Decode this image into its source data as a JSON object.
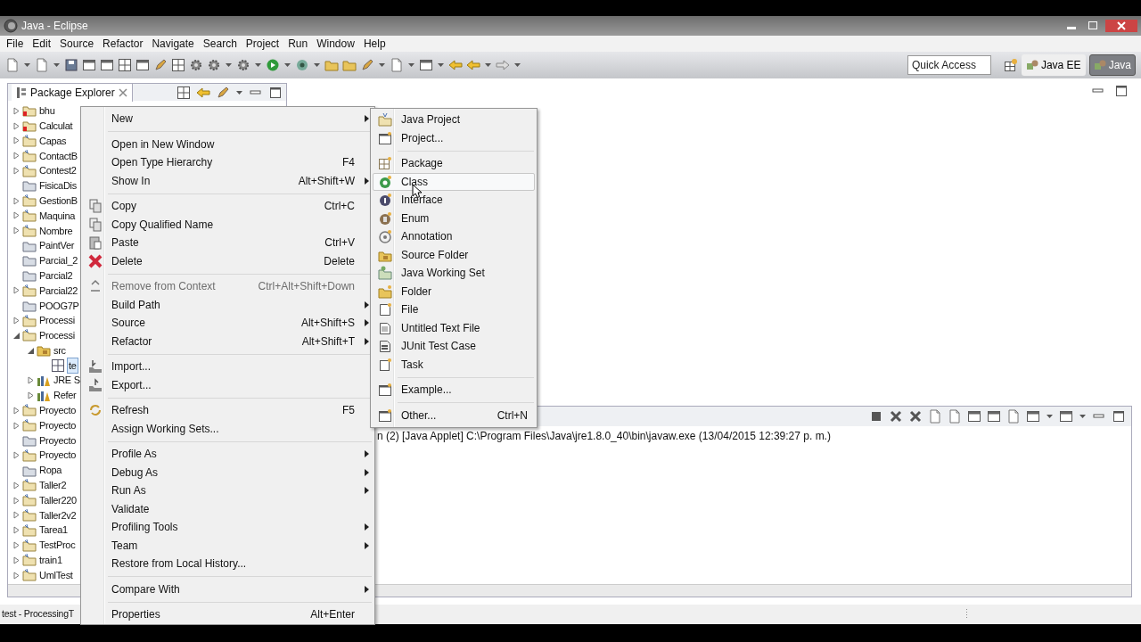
{
  "window": {
    "title": "Java - Eclipse"
  },
  "menu_bar": [
    "File",
    "Edit",
    "Source",
    "Refactor",
    "Navigate",
    "Search",
    "Project",
    "Run",
    "Window",
    "Help"
  ],
  "toolbar": {
    "quick_access": {
      "placeholder": "Quick Access"
    },
    "perspectives": [
      {
        "label": "Java EE",
        "selected": false
      },
      {
        "label": "Java",
        "selected": true
      }
    ]
  },
  "package_explorer": {
    "title": "Package Explorer",
    "tree": [
      {
        "label": "bhu",
        "kind": "project_error",
        "expanded": false,
        "selected": false
      },
      {
        "label": "Calculat",
        "kind": "project_error",
        "expanded": false,
        "selected": false
      },
      {
        "label": "Capas",
        "kind": "project",
        "expanded": false,
        "selected": false
      },
      {
        "label": "ContactB",
        "kind": "project",
        "expanded": false,
        "selected": false
      },
      {
        "label": "Contest2",
        "kind": "project",
        "expanded": false,
        "selected": false
      },
      {
        "label": "FisicaDis",
        "kind": "folder",
        "selected": false
      },
      {
        "label": "GestionB",
        "kind": "project",
        "expanded": false,
        "selected": false
      },
      {
        "label": "Maquina",
        "kind": "project",
        "expanded": false,
        "selected": false
      },
      {
        "label": "Nombre",
        "kind": "project",
        "expanded": false,
        "selected": false
      },
      {
        "label": "PaintVer",
        "kind": "folder",
        "selected": false
      },
      {
        "label": "Parcial_2",
        "kind": "folder",
        "selected": false
      },
      {
        "label": "Parcial2",
        "kind": "folder",
        "selected": false
      },
      {
        "label": "Parcial22",
        "kind": "project",
        "expanded": false,
        "selected": false
      },
      {
        "label": "POOG7P",
        "kind": "folder",
        "selected": false
      },
      {
        "label": "Processi",
        "kind": "project",
        "expanded": false,
        "selected": false
      },
      {
        "label": "Processi",
        "kind": "project",
        "expanded": true,
        "selected": false,
        "children": [
          {
            "label": "src",
            "kind": "source",
            "expanded": true,
            "selected": false,
            "children": [
              {
                "label": "te",
                "kind": "package",
                "selected": true
              }
            ]
          },
          {
            "label": "JRE S",
            "kind": "library",
            "expanded": false,
            "selected": false
          },
          {
            "label": "Refer",
            "kind": "library",
            "expanded": false,
            "selected": false
          }
        ]
      },
      {
        "label": "Proyecto",
        "kind": "project",
        "expanded": false,
        "selected": false
      },
      {
        "label": "Proyecto",
        "kind": "project",
        "expanded": false,
        "selected": false
      },
      {
        "label": "Proyecto",
        "kind": "folder",
        "selected": false
      },
      {
        "label": "Proyecto",
        "kind": "project",
        "expanded": false,
        "selected": false
      },
      {
        "label": "Ropa",
        "kind": "folder",
        "selected": false
      },
      {
        "label": "Taller2",
        "kind": "project",
        "expanded": false,
        "selected": false
      },
      {
        "label": "Taller220",
        "kind": "project",
        "expanded": false,
        "selected": false
      },
      {
        "label": "Taller2v2",
        "kind": "project",
        "expanded": false,
        "selected": false
      },
      {
        "label": "Tarea1",
        "kind": "project",
        "expanded": false,
        "selected": false
      },
      {
        "label": "TestProc",
        "kind": "project",
        "expanded": false,
        "selected": false
      },
      {
        "label": "train1",
        "kind": "project",
        "expanded": false,
        "selected": false
      },
      {
        "label": "UmlTest",
        "kind": "project",
        "expanded": false,
        "selected": false
      }
    ]
  },
  "context_menu": {
    "items": [
      {
        "kind": "item",
        "label": "New",
        "submenu": true,
        "disabled": false
      },
      {
        "kind": "separator"
      },
      {
        "kind": "item",
        "label": "Open in New Window",
        "submenu": false,
        "disabled": false
      },
      {
        "kind": "item",
        "label": "Open Type Hierarchy",
        "shortcut": "F4",
        "submenu": false,
        "disabled": false
      },
      {
        "kind": "item",
        "label": "Show In",
        "shortcut": "Alt+Shift+W",
        "submenu": true,
        "disabled": false
      },
      {
        "kind": "separator"
      },
      {
        "kind": "item",
        "label": "Copy",
        "shortcut": "Ctrl+C",
        "submenu": false,
        "disabled": false
      },
      {
        "kind": "item",
        "label": "Copy Qualified Name",
        "submenu": false,
        "disabled": false
      },
      {
        "kind": "item",
        "label": "Paste",
        "shortcut": "Ctrl+V",
        "submenu": false,
        "disabled": false
      },
      {
        "kind": "item",
        "label": "Delete",
        "shortcut": "Delete",
        "submenu": false,
        "disabled": false
      },
      {
        "kind": "separator"
      },
      {
        "kind": "item",
        "label": "Remove from Context",
        "shortcut": "Ctrl+Alt+Shift+Down",
        "submenu": false,
        "disabled": true
      },
      {
        "kind": "item",
        "label": "Build Path",
        "submenu": true,
        "disabled": false
      },
      {
        "kind": "item",
        "label": "Source",
        "shortcut": "Alt+Shift+S",
        "submenu": true,
        "disabled": false
      },
      {
        "kind": "item",
        "label": "Refactor",
        "shortcut": "Alt+Shift+T",
        "submenu": true,
        "disabled": false
      },
      {
        "kind": "separator"
      },
      {
        "kind": "item",
        "label": "Import...",
        "submenu": false,
        "disabled": false
      },
      {
        "kind": "item",
        "label": "Export...",
        "submenu": false,
        "disabled": false
      },
      {
        "kind": "separator"
      },
      {
        "kind": "item",
        "label": "Refresh",
        "shortcut": "F5",
        "submenu": false,
        "disabled": false
      },
      {
        "kind": "item",
        "label": "Assign Working Sets...",
        "submenu": false,
        "disabled": false
      },
      {
        "kind": "separator"
      },
      {
        "kind": "item",
        "label": "Profile As",
        "submenu": true,
        "disabled": false
      },
      {
        "kind": "item",
        "label": "Debug As",
        "submenu": true,
        "disabled": false
      },
      {
        "kind": "item",
        "label": "Run As",
        "submenu": true,
        "disabled": false
      },
      {
        "kind": "item",
        "label": "Validate",
        "submenu": false,
        "disabled": false
      },
      {
        "kind": "item",
        "label": "Profiling Tools",
        "submenu": true,
        "disabled": false
      },
      {
        "kind": "item",
        "label": "Team",
        "submenu": true,
        "disabled": false
      },
      {
        "kind": "item",
        "label": "Restore from Local History...",
        "submenu": false,
        "disabled": false
      },
      {
        "kind": "separator"
      },
      {
        "kind": "item",
        "label": "Compare With",
        "submenu": true,
        "disabled": false
      },
      {
        "kind": "separator"
      },
      {
        "kind": "item",
        "label": "Properties",
        "shortcut": "Alt+Enter",
        "submenu": false,
        "disabled": false
      }
    ]
  },
  "new_submenu": {
    "items": [
      {
        "kind": "item",
        "label": "Java Project",
        "selected": false
      },
      {
        "kind": "item",
        "label": "Project...",
        "selected": false
      },
      {
        "kind": "separator"
      },
      {
        "kind": "item",
        "label": "Package",
        "selected": false
      },
      {
        "kind": "item",
        "label": "Class",
        "selected": true
      },
      {
        "kind": "item",
        "label": "Interface",
        "selected": false
      },
      {
        "kind": "item",
        "label": "Enum",
        "selected": false
      },
      {
        "kind": "item",
        "label": "Annotation",
        "selected": false
      },
      {
        "kind": "item",
        "label": "Source Folder",
        "selected": false
      },
      {
        "kind": "item",
        "label": "Java Working Set",
        "selected": false
      },
      {
        "kind": "item",
        "label": "Folder",
        "selected": false
      },
      {
        "kind": "item",
        "label": "File",
        "selected": false
      },
      {
        "kind": "item",
        "label": "Untitled Text File",
        "selected": false
      },
      {
        "kind": "item",
        "label": "JUnit Test Case",
        "selected": false
      },
      {
        "kind": "item",
        "label": "Task",
        "selected": false
      },
      {
        "kind": "separator"
      },
      {
        "kind": "item",
        "label": "Example...",
        "selected": false
      },
      {
        "kind": "separator"
      },
      {
        "kind": "item",
        "label": "Other...",
        "shortcut": "Ctrl+N",
        "selected": false
      }
    ]
  },
  "console": {
    "text": "n (2) [Java Applet] C:\\Program Files\\Java\\jre1.8.0_40\\bin\\javaw.exe (13/04/2015 12:39:27 p. m.)"
  },
  "status_bar": {
    "text": "test - ProcessingT"
  }
}
